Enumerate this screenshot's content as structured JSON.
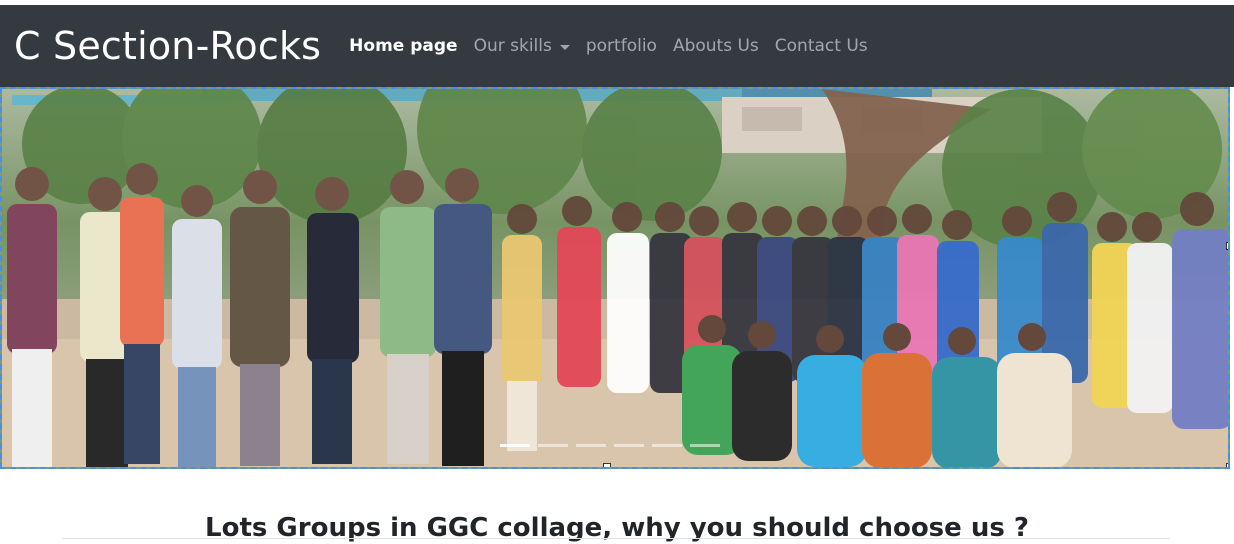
{
  "brand": "C Section-Rocks",
  "nav": [
    {
      "label": "Home page",
      "active": true
    },
    {
      "label": "Our skills",
      "dropdown": true
    },
    {
      "label": "portfolio"
    },
    {
      "label": "Abouts Us"
    },
    {
      "label": "Contact Us"
    }
  ],
  "carousel": {
    "slide_count": 6,
    "active_index": 0
  },
  "heading": "Lots Groups in GGC collage, why you should choose us ?",
  "colors": {
    "navbar": "#343a40",
    "nav_active": "#ffffff",
    "nav_inactive": "rgba(255,255,255,0.55)",
    "selection": "#4a90e2"
  },
  "icons": {
    "dropdown": "chevron-down-icon"
  }
}
